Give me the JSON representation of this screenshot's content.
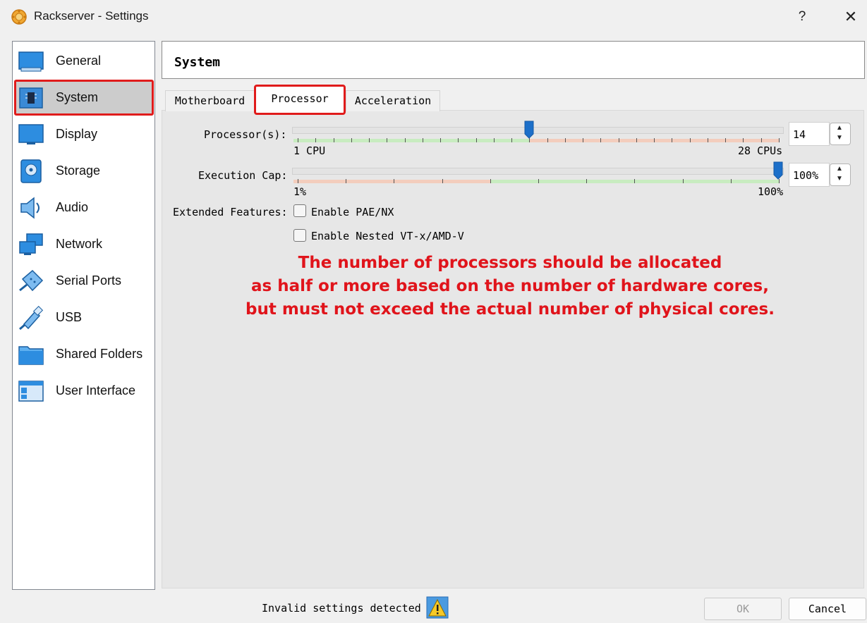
{
  "window": {
    "title": "Rackserver - Settings",
    "help": "?",
    "close": "✕"
  },
  "sidebar": {
    "items": [
      {
        "label": "General",
        "icon": "general-icon"
      },
      {
        "label": "System",
        "icon": "system-icon",
        "selected": true
      },
      {
        "label": "Display",
        "icon": "display-icon"
      },
      {
        "label": "Storage",
        "icon": "storage-icon"
      },
      {
        "label": "Audio",
        "icon": "audio-icon"
      },
      {
        "label": "Network",
        "icon": "network-icon"
      },
      {
        "label": "Serial Ports",
        "icon": "serial-ports-icon"
      },
      {
        "label": "USB",
        "icon": "usb-icon"
      },
      {
        "label": "Shared Folders",
        "icon": "shared-folders-icon"
      },
      {
        "label": "User Interface",
        "icon": "user-interface-icon"
      }
    ]
  },
  "header": {
    "title": "System"
  },
  "tabs": [
    {
      "label": "Motherboard",
      "active": false
    },
    {
      "label": "Processor",
      "active": true
    },
    {
      "label": "Acceleration",
      "active": false
    }
  ],
  "processor": {
    "processors_label": "Processor(s):",
    "processors_value": "14",
    "processors_min_label": "1 CPU",
    "processors_max_label": "28 CPUs",
    "processors_min": 1,
    "processors_max": 28,
    "exec_cap_label": "Execution Cap:",
    "exec_cap_value": "100%",
    "exec_cap_min_label": "1%",
    "exec_cap_max_label": "100%",
    "extended_label": "Extended Features:",
    "pae_label": "Enable PAE/NX",
    "pae_checked": false,
    "nested_label": "Enable Nested VT-x/AMD-V",
    "nested_checked": false
  },
  "annotation": {
    "lines": [
      "The number of processors should be allocated",
      "as half or more based on the number of hardware cores,",
      "but must not exceed the actual number of physical cores."
    ],
    "color": "#e0141b"
  },
  "footer": {
    "invalid_text": "Invalid settings detected",
    "ok_label": "OK",
    "cancel_label": "Cancel"
  },
  "colors": {
    "highlight": "#e01b1b",
    "accent": "#1c6fc9",
    "green_band": "#c8ecc0",
    "red_band": "#f3cdbd"
  }
}
